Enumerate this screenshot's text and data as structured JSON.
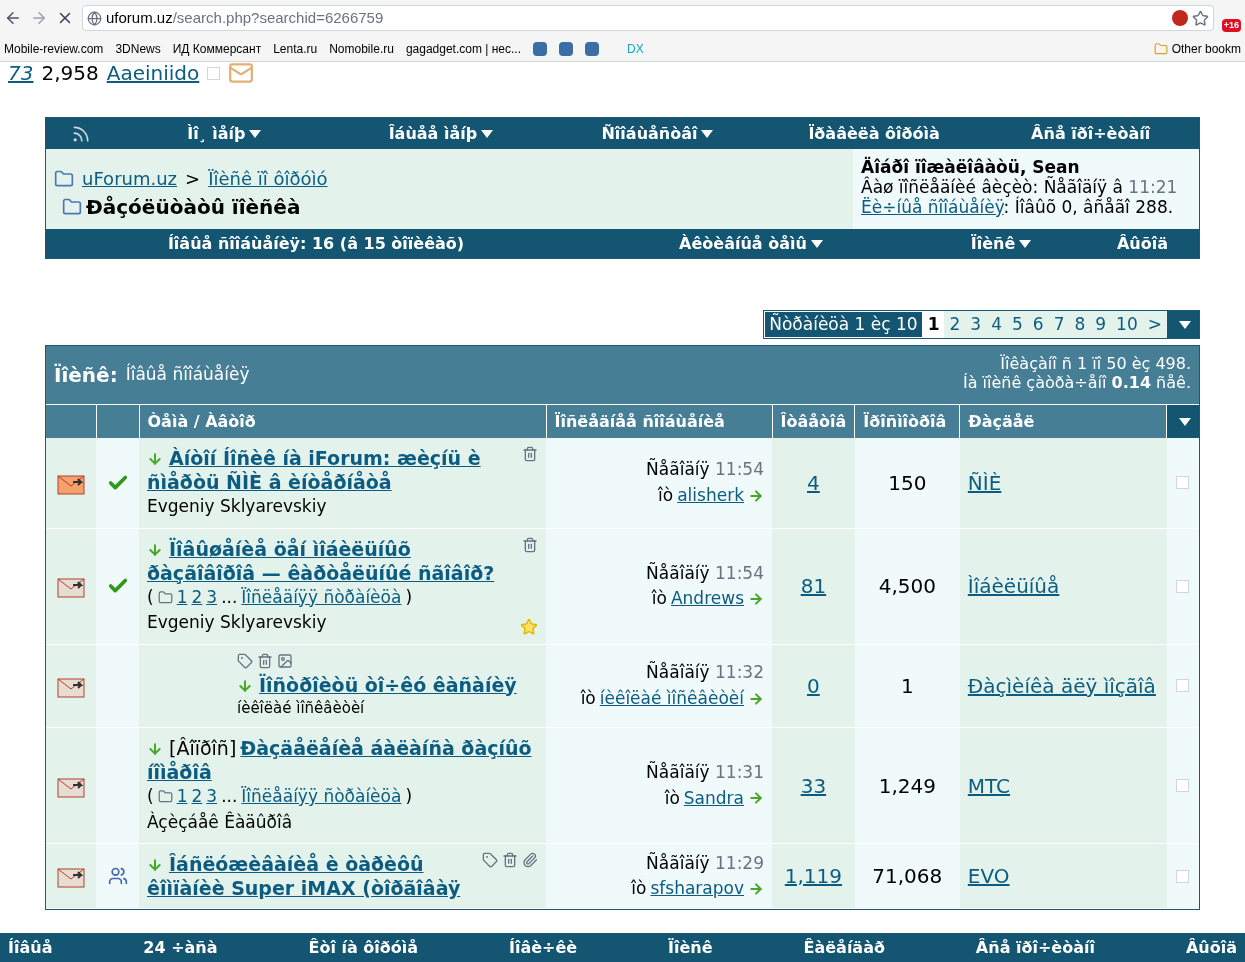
{
  "browser": {
    "url_host": "uforum.uz",
    "url_path": "/search.php?searchid=6266759",
    "badge": "+16",
    "bookmarks": [
      {
        "label": "Mobile-review.com",
        "kind": "text"
      },
      {
        "label": "3DNews",
        "kind": "text"
      },
      {
        "label": "ИД Коммерсант",
        "kind": "text"
      },
      {
        "label": "Lenta.ru",
        "kind": "text"
      },
      {
        "label": "Nomobile.ru",
        "kind": "text"
      },
      {
        "label": "gagadget.com | нес...",
        "kind": "text"
      },
      {
        "kind": "icon"
      },
      {
        "kind": "icon"
      },
      {
        "kind": "icon"
      },
      {
        "label": "DX",
        "kind": "text"
      }
    ],
    "other_bookmarks": "Other bookm"
  },
  "cut_row": {
    "link": "73",
    "views": "2,958",
    "section": "Aaeiniido",
    "checked": false
  },
  "nav": [
    "Ìî¸ ìåíþ",
    "Îáùåå ìåíþ",
    "Ñîîáùåñòâî",
    "Ïðàâèëà ôîðóìà",
    "Âñå ïðî÷èòàíî"
  ],
  "breadcrumb": {
    "home": "uForum.uz",
    "separator": ">",
    "parent": "Ïîèñê ïî ôîðóìó",
    "title": "Ðåçóëüòàòû ïîèñêà"
  },
  "welcome": {
    "greeting": "Äîáðî ïîæàëîâàòü, Sean",
    "last_visit": "Âàø ïîñëåäíèé âèçèò: Ñåãîäíÿ â",
    "last_visit_time": "11:21",
    "pm_link": "Ëè÷íûå ñîîáùåíèÿ",
    "pm_info": ": Íîâûõ 0, âñåãî 288."
  },
  "subnav": [
    {
      "label": "Íîâûå ñîîáùåíèÿ: 16 (â 15 òîïèêàõ)",
      "dropdown": false
    },
    {
      "label": "Àêòèâíûå òåìû",
      "dropdown": true
    },
    {
      "label": "Ïîèñê",
      "dropdown": true
    },
    {
      "label": "Âûõîä",
      "dropdown": false
    }
  ],
  "pagination": {
    "label": "Ñòðàíèöà 1 èç 10",
    "pages": [
      {
        "label": "1",
        "selected": true
      },
      {
        "label": "2",
        "selected": false
      },
      {
        "label": "3",
        "selected": false
      },
      {
        "label": "4",
        "selected": false
      },
      {
        "label": "5",
        "selected": false
      },
      {
        "label": "6",
        "selected": false
      },
      {
        "label": "7",
        "selected": false
      },
      {
        "label": "8",
        "selected": false
      },
      {
        "label": "9",
        "selected": false
      },
      {
        "label": "10",
        "selected": false
      }
    ],
    "next": ">"
  },
  "results": {
    "label": "Ïîèñê:",
    "query": "Íîâûå ñîîáùåíèÿ",
    "shown": "Ïîêàçàíî ñ 1 ïî 50 èç 498.",
    "time": "Íà ïîèñê çàòðà÷åíî **0.14** ñåê.",
    "columns": [
      "Òåìà / Àâòîð",
      "Ïîñëåäíåå ñîîáùåíèå",
      "Îòâåòîâ",
      "Ïðîñìîòðîâ",
      "Ðàçäåë"
    ],
    "rows": [
      {
        "marker": {
          "kind": "check"
        },
        "indented": false,
        "title": "Àíòîí Íîñèê íà iForum: æèçíü è ñìåðòü ÑÌÈ â èíòåðíåòå",
        "author": "Evgeniy Sklyarevskiy",
        "tools": [
          {
            "kind": "trash"
          }
        ],
        "starred": false,
        "last_day": "Ñåãîäíÿ",
        "last_time": "11:54",
        "by": "îò",
        "last_user": "alisherk",
        "replies": "4",
        "views": "150",
        "section": "ÑÌÈ",
        "checked": false
      },
      {
        "marker": {
          "kind": "check"
        },
        "indented": false,
        "title": "Ïîâûøåíèå öåí ìîáèëüíûõ ðàçãîâîðîâ — êàðòåëüíûé ñãîâîð?",
        "pages": {
          "open": "(",
          "links": [
            "1",
            "2",
            "3"
          ],
          "ellipsis": "...",
          "last": "Ïîñëåäíÿÿ ñòðàíèöà",
          "close": ")"
        },
        "author": "Evgeniy Sklyarevskiy",
        "tools": [
          {
            "kind": "trash"
          }
        ],
        "starred": true,
        "last_day": "Ñåãîäíÿ",
        "last_time": "11:54",
        "by": "îò",
        "last_user": "Andrews",
        "replies": "81",
        "views": "4,500",
        "section": "Ìîáèëüíûå",
        "checked": false
      },
      {
        "indented": true,
        "title": "Ïîñòðîèòü òî÷êó êàñàíèÿ",
        "author": "íèêîëàé ìîñêâèòèí",
        "tools": [
          {
            "kind": "tag"
          },
          {
            "kind": "trash"
          },
          {
            "kind": "image"
          }
        ],
        "starred": false,
        "last_day": "Ñåãîäíÿ",
        "last_time": "11:32",
        "by": "îò",
        "last_user": "íèêîëàé ìîñêâèòèí",
        "replies": "0",
        "views": "1",
        "section": "Ðàçìèíêà äëÿ ìîçãîâ",
        "checked": false
      },
      {
        "indented": false,
        "prefix": "[Âîïðîñ]",
        "title": "Ðàçäåëåíèå áàëàíñà ðàçíûõ íîìåðîâ",
        "pages": {
          "open": "(",
          "links": [
            "1",
            "2",
            "3"
          ],
          "ellipsis": "...",
          "last": "Ïîñëåäíÿÿ ñòðàíèöà",
          "close": ")"
        },
        "author": "Àçèçáåê Êàäûðîâ",
        "tools": [],
        "starred": false,
        "last_day": "Ñåãîäíÿ",
        "last_time": "11:31",
        "by": "îò",
        "last_user": "Sandra",
        "replies": "33",
        "views": "1,249",
        "section": "MTC",
        "checked": false
      },
      {
        "marker": {
          "kind": "users"
        },
        "indented": false,
        "title": "Îáñëóæèâàíèå è òàðèôû êîìïàíèè Super iMAX (òîðãîâàÿ",
        "tools": [
          {
            "kind": "tag"
          },
          {
            "kind": "trash"
          },
          {
            "kind": "clip"
          }
        ],
        "starred": false,
        "last_day": "Ñåãîäíÿ",
        "last_time": "11:29",
        "by": "îò",
        "last_user": "sfsharapov",
        "replies": "1,119",
        "views": "71,068",
        "section": "EVO",
        "checked": false
      }
    ]
  },
  "footer": [
    "Íîâûå",
    "24 ÷àñà",
    "Êòî íà ôîðóìå",
    "Íîâè÷êè",
    "Ïîèñê",
    "Êàëåíäàð",
    "Âñå ïðî÷èòàíî",
    "Âûõîä"
  ]
}
